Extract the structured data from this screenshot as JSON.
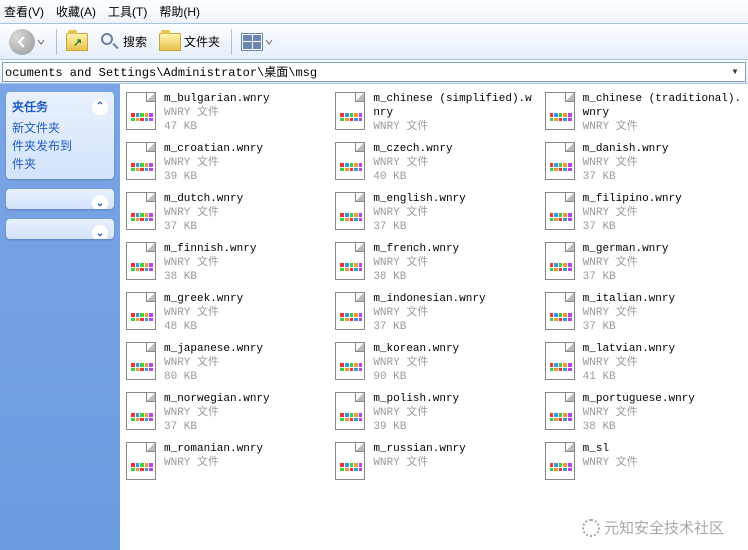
{
  "menu": {
    "view": "查看(V)",
    "fav": "收藏(A)",
    "tools": "工具(T)",
    "help": "帮助(H)"
  },
  "toolbar": {
    "search": "搜索",
    "folders": "文件夹"
  },
  "address": {
    "path": "ocuments and Settings\\Administrator\\桌面\\msg"
  },
  "sidebar": {
    "tasks_title": "夹任务",
    "tasks": [
      "新文件夹",
      "件夹发布到",
      "件夹"
    ]
  },
  "common": {
    "filetype": "WNRY 文件"
  },
  "files": [
    {
      "name": "m_bulgarian.wnry",
      "size": "47 KB"
    },
    {
      "name": "m_chinese (simplified).wnry",
      "size": "WNRY 文件"
    },
    {
      "name": "m_chinese (traditional).wnry",
      "size": "WNRY 文件"
    },
    {
      "name": "m_croatian.wnry",
      "size": "39 KB"
    },
    {
      "name": "m_czech.wnry",
      "size": "40 KB"
    },
    {
      "name": "m_danish.wnry",
      "size": "37 KB"
    },
    {
      "name": "m_dutch.wnry",
      "size": "37 KB"
    },
    {
      "name": "m_english.wnry",
      "size": "37 KB"
    },
    {
      "name": "m_filipino.wnry",
      "size": "37 KB"
    },
    {
      "name": "m_finnish.wnry",
      "size": "38 KB"
    },
    {
      "name": "m_french.wnry",
      "size": "38 KB"
    },
    {
      "name": "m_german.wnry",
      "size": "37 KB"
    },
    {
      "name": "m_greek.wnry",
      "size": "48 KB"
    },
    {
      "name": "m_indonesian.wnry",
      "size": "37 KB"
    },
    {
      "name": "m_italian.wnry",
      "size": "37 KB"
    },
    {
      "name": "m_japanese.wnry",
      "size": "80 KB"
    },
    {
      "name": "m_korean.wnry",
      "size": "90 KB"
    },
    {
      "name": "m_latvian.wnry",
      "size": "41 KB"
    },
    {
      "name": "m_norwegian.wnry",
      "size": "37 KB"
    },
    {
      "name": "m_polish.wnry",
      "size": "39 KB"
    },
    {
      "name": "m_portuguese.wnry",
      "size": "38 KB"
    },
    {
      "name": "m_romanian.wnry",
      "size": ""
    },
    {
      "name": "m_russian.wnry",
      "size": ""
    },
    {
      "name": "m_sl",
      "size": ""
    }
  ],
  "watermark": "元知安全技术社区"
}
